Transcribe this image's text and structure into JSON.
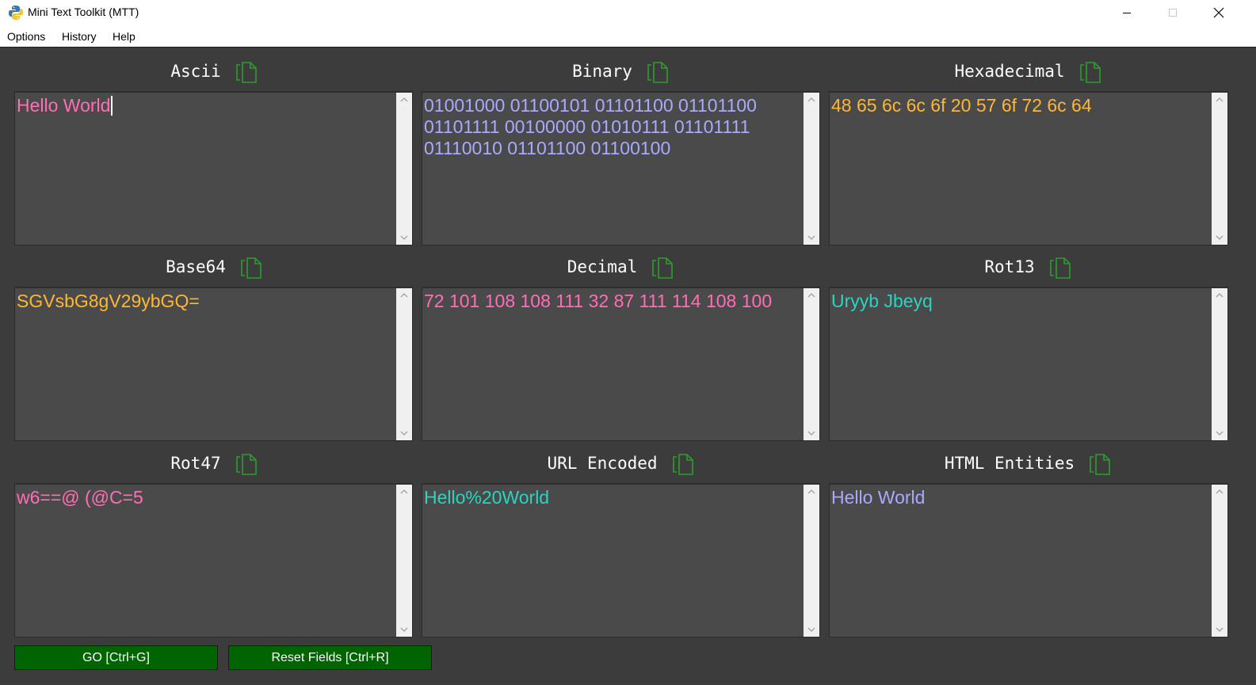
{
  "window": {
    "title": "Mini Text Toolkit (MTT)",
    "minimize_icon": "minimize-icon",
    "maximize_icon": "maximize-icon",
    "close_icon": "close-icon"
  },
  "menu": {
    "options": "Options",
    "history": "History",
    "help": "Help"
  },
  "panels": [
    {
      "label": "Ascii",
      "value": "Hello World",
      "color": "#ff6eb4"
    },
    {
      "label": "Binary",
      "value": "01001000 01100101 01101100 01101100 01101111 00100000 01010111 01101111 01110010 01101100 01100100",
      "color": "#a9a9ff"
    },
    {
      "label": "Hexadecimal",
      "value": "48 65 6c 6c 6f 20 57 6f 72 6c 64",
      "color": "#ffb732"
    },
    {
      "label": "Base64",
      "value": "SGVsbG8gV29ybGQ=",
      "color": "#ffb732"
    },
    {
      "label": "Decimal",
      "value": "72 101 108 108 111 32 87 111 114 108 100",
      "color": "#ff6eb4"
    },
    {
      "label": "Rot13",
      "value": "Uryyb Jbeyq",
      "color": "#2ad4c0"
    },
    {
      "label": "Rot47",
      "value": "w6==@ (@C=5",
      "color": "#ff6eb4"
    },
    {
      "label": "URL Encoded",
      "value": "Hello%20World",
      "color": "#2ad4c0"
    },
    {
      "label": "HTML Entities",
      "value": "Hello World",
      "color": "#a9a9ff"
    }
  ],
  "buttons": {
    "go": "GO [Ctrl+G]",
    "reset": "Reset Fields [Ctrl+R]"
  },
  "theme": {
    "background": "#3c3c3c",
    "textbox": "#4a4a4a",
    "button": "#006400",
    "copy_icon_color": "#2e9b2e"
  }
}
